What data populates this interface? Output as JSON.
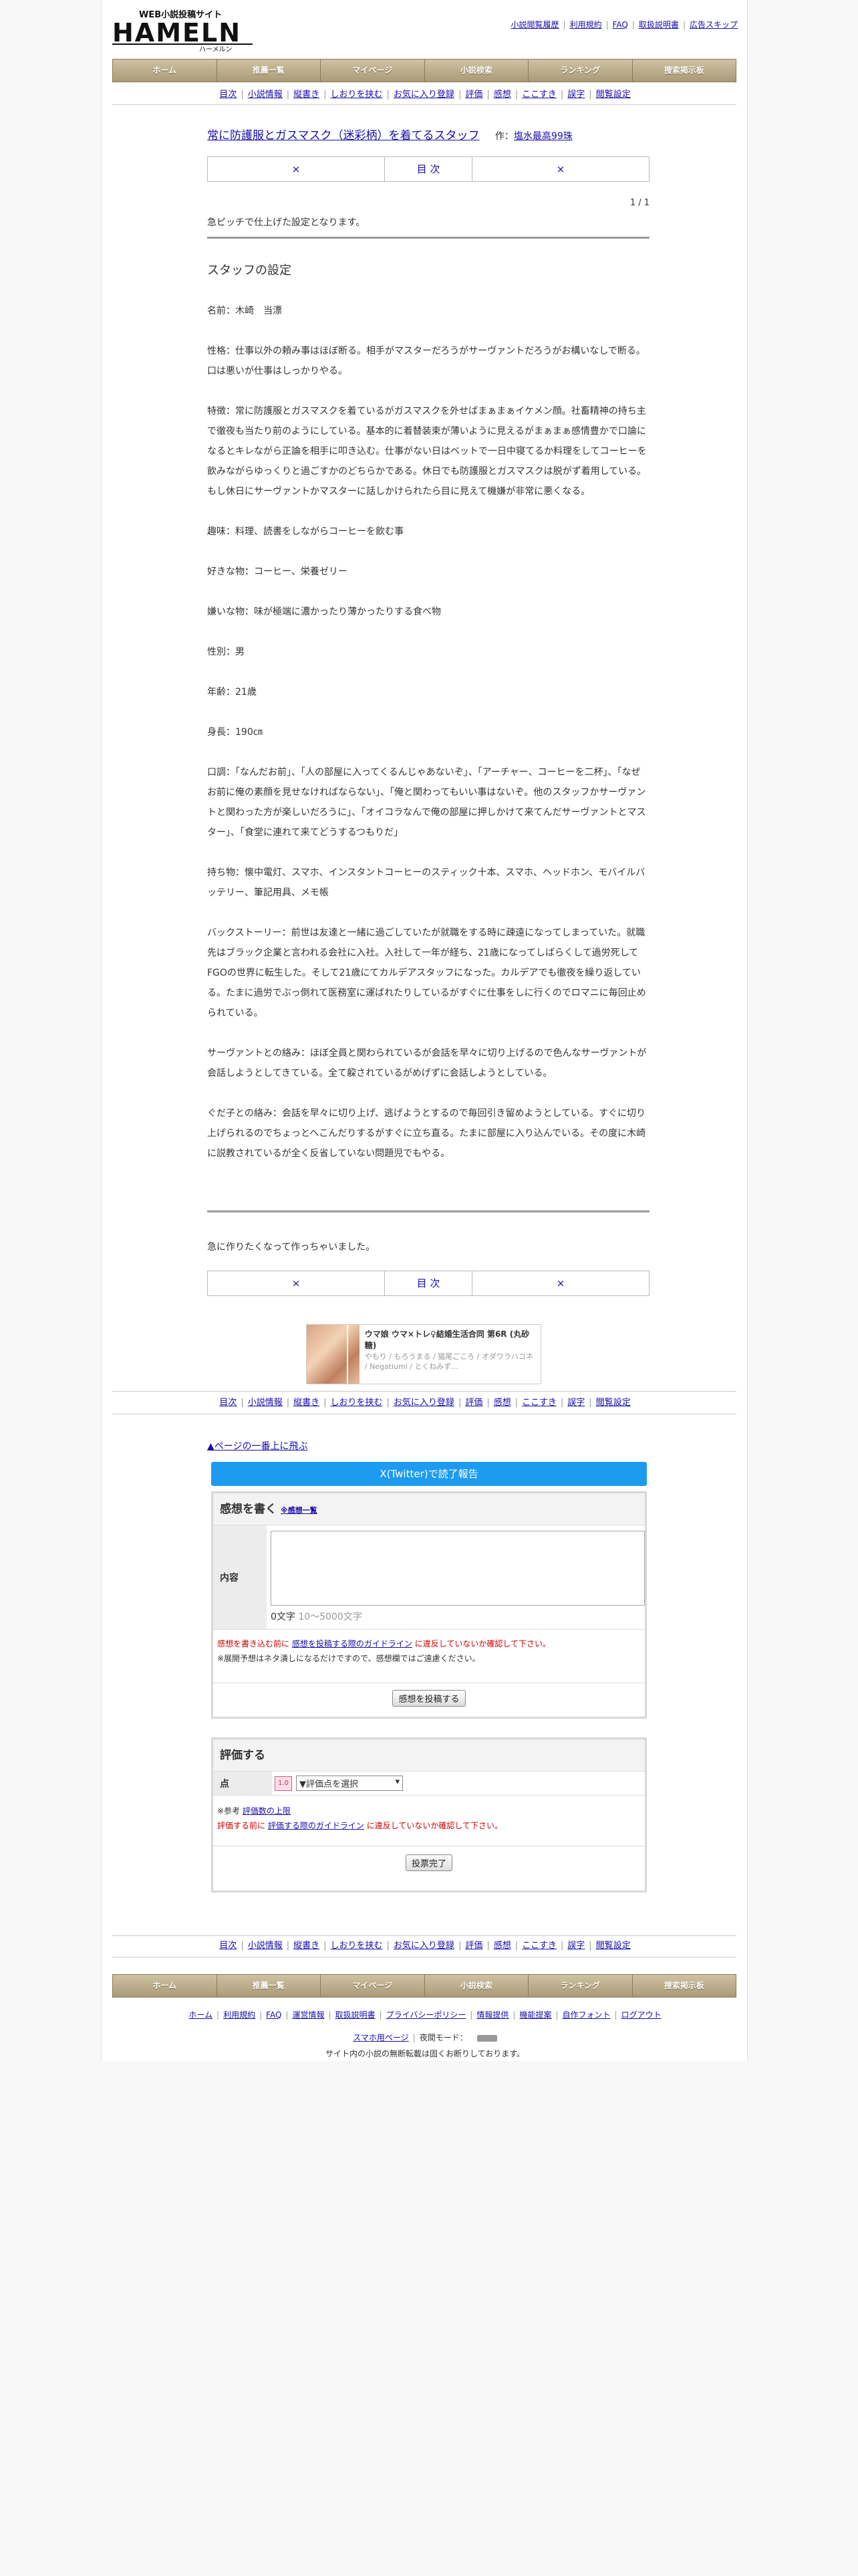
{
  "header": {
    "logo_text": "WEB小説投稿サイト",
    "logo_main": "HAMELN",
    "logo_sub": "ハーメルン",
    "links": [
      "小説閲覧履歴",
      "利用規約",
      "FAQ",
      "取扱説明書",
      "広告スキップ"
    ]
  },
  "global_nav": [
    "ホーム",
    "推薦一覧",
    "マイページ",
    "小説検索",
    "ランキング",
    "捜索掲示板"
  ],
  "sub_nav": [
    "目次",
    "小説情報",
    "縦書き",
    "しおりを挟む",
    "お気に入り登録",
    "評価",
    "感想",
    "ここすき",
    "誤字",
    "閲覧設定"
  ],
  "novel": {
    "title": "常に防護服とガスマスク（迷彩柄）を着てるスタッフ",
    "author_label": "作：",
    "author": "塩水最高99珠"
  },
  "chapter_nav": {
    "prev": "×",
    "toc": "目 次",
    "next": "×"
  },
  "pager": "1 / 1",
  "preface": "急ピッチで仕上げた設定となります。",
  "body": {
    "heading": "スタッフの設定",
    "paragraphs": [
      "名前：木崎　当漂",
      "性格：仕事以外の頼み事はほぼ断る。相手がマスターだろうがサーヴァントだろうがお構いなしで断る。口は悪いが仕事はしっかりやる。",
      "特徴：常に防護服とガスマスクを着ているがガスマスクを外せばまぁまぁイケメン顔。社畜精神の持ち主で徹夜も当たり前のようにしている。基本的に着替装束が薄いように見えるがまぁまぁ感情豊かで口論になるとキレながら正論を相手に叩き込む。仕事がない日はベットで一日中寝てるか料理をしてコーヒーを飲みながらゆっくりと過ごすかのどちらかである。休日でも防護服とガスマスクは脱がず着用している。もし休日にサーヴァントかマスターに話しかけられたら目に見えて機嫌が非常に悪くなる。",
      "趣味：料理、読書をしながらコーヒーを飲む事",
      "好きな物：コーヒー、栄養ゼリー",
      "嫌いな物：味が極端に濃かったり薄かったりする食べ物",
      "性別：男",
      "年齢：21歳",
      "身長：190㎝",
      "口調：「なんだお前」、「人の部屋に入ってくるんじゃあないぞ」、「アーチャー、コーヒーを二杯」、「なぜお前に俺の素顔を見せなければならない」、「俺と関わってもいい事はないぞ。他のスタッフかサーヴァントと関わった方が楽しいだろうに」、「オイコラなんで俺の部屋に押しかけて来てんだサーヴァントとマスター」、「食堂に連れて来てどうするつもりだ」",
      "持ち物：懐中電灯、スマホ、インスタントコーヒーのスティック十本、スマホ、ヘッドホン、モバイルバッテリー、筆記用具、メモ帳",
      "バックストーリー：前世は友達と一緒に過ごしていたが就職をする時に疎遠になってしまっていた。就職先はブラック企業と言われる会社に入社。入社して一年が経ち、21歳になってしばらくして過労死してFGOの世界に転生した。そして21歳にてカルデアスタッフになった。カルデアでも徹夜を繰り返している。たまに過労でぶっ倒れて医務室に運ばれたりしているがすぐに仕事をしに行くのでロマニに毎回止められている。",
      "サーヴァントとの絡み：ほぼ全員と関わられているが会話を早々に切り上げるので色んなサーヴァントが会話しようとしてきている。全て躱されているがめげずに会話しようとしている。",
      "ぐだ子との絡み：会話を早々に切り上げ、逃げようとするので毎回引き留めようとしている。すぐに切り上げられるのでちょっとへこんだりするがすぐに立ち直る。たまに部屋に入り込んでいる。その度に木崎に説教されているが全く反省していない問題児でもやる。"
    ]
  },
  "afterword": "急に作りたくなって作っちゃいました。",
  "ad": {
    "title": "ウマ娘 ウマ×トレ♀結婚生活合同 第6R (丸砂糖)",
    "tags": "やもり / もろうまる / 猫尾ごころ / オダワラハコネ / Negatiumi / とくねみず..."
  },
  "page_top": "▲ページの一番上に飛ぶ",
  "twitter_button": "X(Twitter)で読了報告",
  "comment": {
    "heading": "感想を書く",
    "list_link": "※感想一覧",
    "content_label": "内容",
    "count": "0文字",
    "count_range": "10～5000文字",
    "warn_prefix": "感想を書き込む前に",
    "warn_link": "感想を投稿する際のガイドライン",
    "warn_suffix": "に違反していないか確認して下さい。",
    "note": "※展開予想はネタ潰しになるだけですので、感想欄ではご遠慮ください。",
    "submit": "感想を投稿する"
  },
  "rating": {
    "heading": "評価する",
    "point_label": "点",
    "icon_text": "1.0",
    "select_default": "▼評価点を選択",
    "ref_prefix": "※参考",
    "ref_link": "評価数の上限",
    "warn_prefix": "評価する前に",
    "warn_link": "評価する際のガイドライン",
    "warn_suffix": "に違反していないか確認して下さい。",
    "submit": "投票完了"
  },
  "footer": {
    "links": [
      "ホーム",
      "利用規約",
      "FAQ",
      "運営情報",
      "取扱説明書",
      "プライバシーポリシー",
      "情報提供",
      "機能提案",
      "自作フォント",
      "ログアウト"
    ],
    "mobile_link": "スマホ用ページ",
    "night_mode": "夜間モード：",
    "notice": "サイト内の小説の無断転載は固くお断りしております。"
  }
}
